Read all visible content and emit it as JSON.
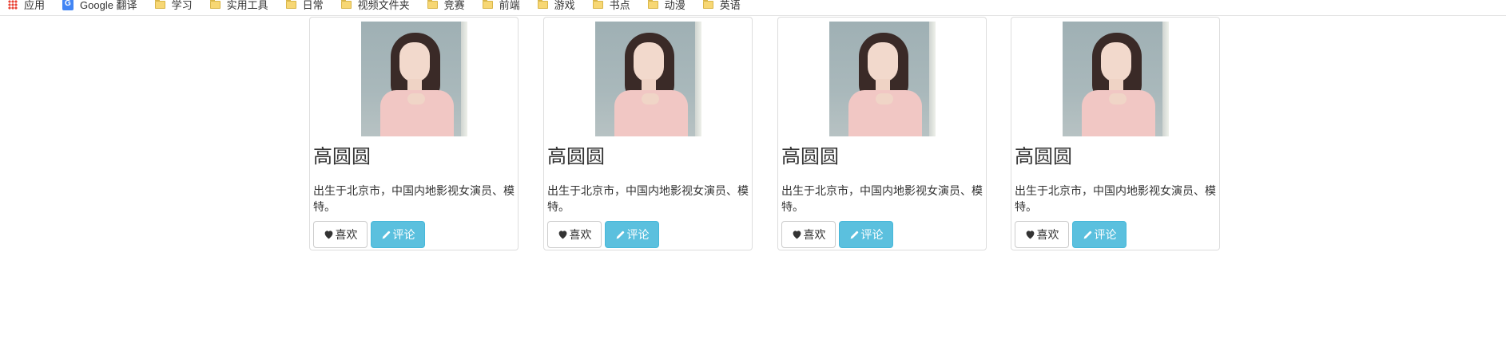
{
  "bookmarks_bar": {
    "items": [
      {
        "label": "应用",
        "icon": "apps-icon"
      },
      {
        "label": "Google 翻译",
        "icon": "google-translate-icon"
      },
      {
        "label": "学习",
        "icon": "folder-icon"
      },
      {
        "label": "实用工具",
        "icon": "folder-icon"
      },
      {
        "label": "日常",
        "icon": "folder-icon"
      },
      {
        "label": "视频文件夹",
        "icon": "folder-icon"
      },
      {
        "label": "竞赛",
        "icon": "folder-icon"
      },
      {
        "label": "前端",
        "icon": "folder-icon"
      },
      {
        "label": "游戏",
        "icon": "folder-icon"
      },
      {
        "label": "书点",
        "icon": "folder-icon"
      },
      {
        "label": "动漫",
        "icon": "folder-icon"
      },
      {
        "label": "英语",
        "icon": "folder-icon"
      }
    ]
  },
  "cards": [
    {
      "name": "高圆圆",
      "description": "出生于北京市，中国内地影视女演员、模特。",
      "like_label": "喜欢",
      "comment_label": "评论"
    },
    {
      "name": "高圆圆",
      "description": "出生于北京市，中国内地影视女演员、模特。",
      "like_label": "喜欢",
      "comment_label": "评论"
    },
    {
      "name": "高圆圆",
      "description": "出生于北京市，中国内地影视女演员、模特。",
      "like_label": "喜欢",
      "comment_label": "评论"
    },
    {
      "name": "高圆圆",
      "description": "出生于北京市，中国内地影视女演员、模特。",
      "like_label": "喜欢",
      "comment_label": "评论"
    }
  ],
  "colors": {
    "info_button": "#5bc0de",
    "default_button_border": "#cccccc",
    "card_border": "#dddddd"
  }
}
